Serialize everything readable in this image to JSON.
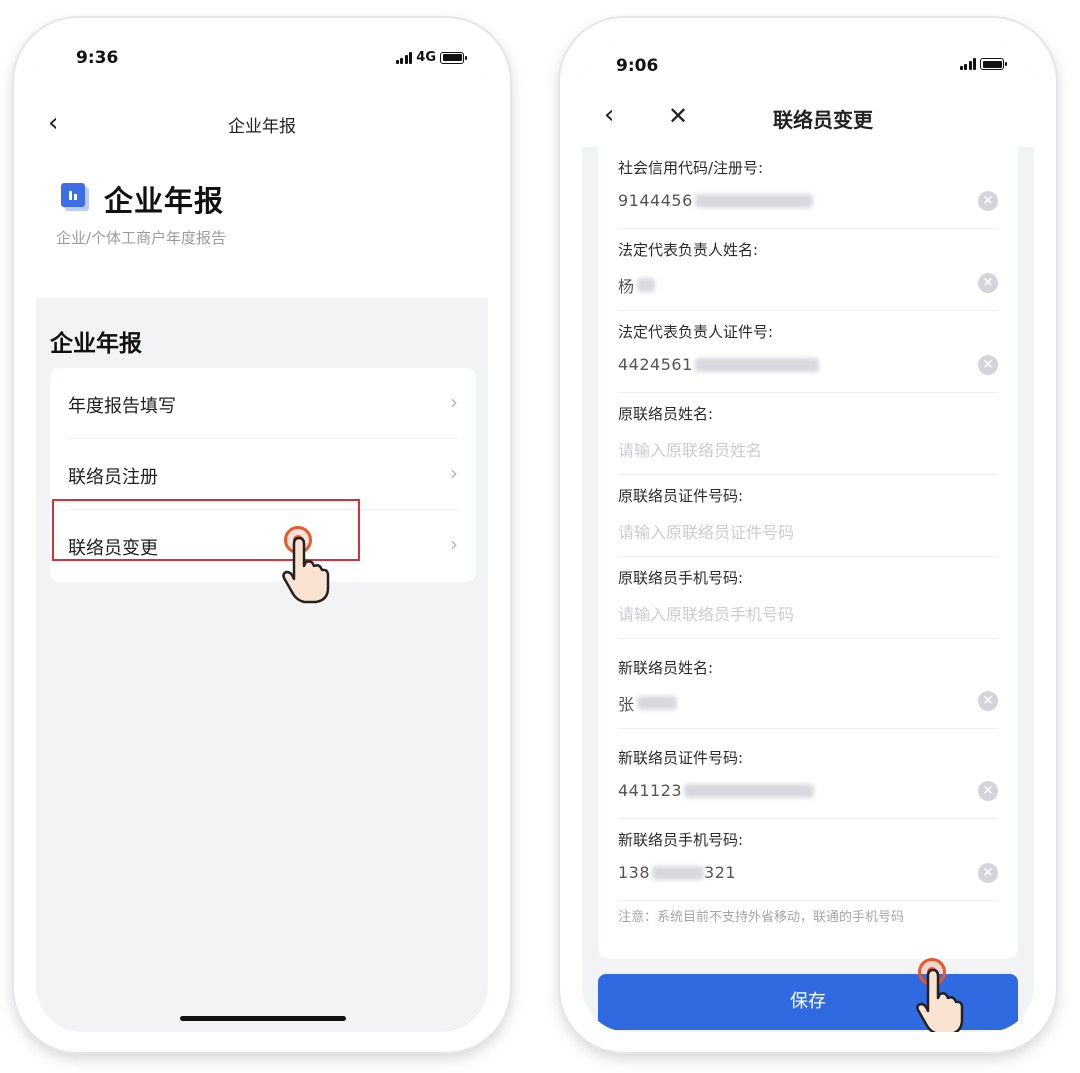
{
  "left_screen": {
    "status_time": "9:36",
    "network": "4G",
    "nav_title": "企业年报",
    "brand_title": "企业年报",
    "brand_subtitle": "企业/个体工商户年度报告",
    "section_title": "企业年报",
    "menu": [
      {
        "label": "年度报告填写",
        "icon": "chevron-right-icon"
      },
      {
        "label": "联络员注册",
        "icon": "chevron-right-icon"
      },
      {
        "label": "联络员变更",
        "icon": "chevron-right-icon",
        "highlighted": true
      }
    ]
  },
  "right_screen": {
    "status_time": "9:06",
    "title": "联络员变更",
    "fields": [
      {
        "label": "社会信用代码/注册号:",
        "value": "9144456",
        "masked": true
      },
      {
        "label": "法定代表负责人姓名:",
        "value": "杨",
        "masked": true
      },
      {
        "label": "法定代表负责人证件号:",
        "value": "4424561",
        "masked": true
      },
      {
        "label": "原联络员姓名:",
        "placeholder": "请输入原联络员姓名"
      },
      {
        "label": "原联络员证件号码:",
        "placeholder": "请输入原联络员证件号码"
      },
      {
        "label": "原联络员手机号码:",
        "placeholder": "请输入原联络员手机号码"
      },
      {
        "label": "新联络员姓名:",
        "value": "张",
        "masked": true
      },
      {
        "label": "新联络员证件号码:",
        "value": "441123",
        "masked": true
      },
      {
        "label": "新联络员手机号码:",
        "value_prefix": "138",
        "value_suffix": "321",
        "masked": true
      }
    ],
    "note": "注意：系统目前不支持外省移动，联通的手机号码",
    "save_label": "保存"
  },
  "colors": {
    "accent": "#2f6ae0",
    "highlight_border": "#d2333a",
    "tap_indicator": "#e8582b",
    "page_bg": "#f2f3f5"
  }
}
